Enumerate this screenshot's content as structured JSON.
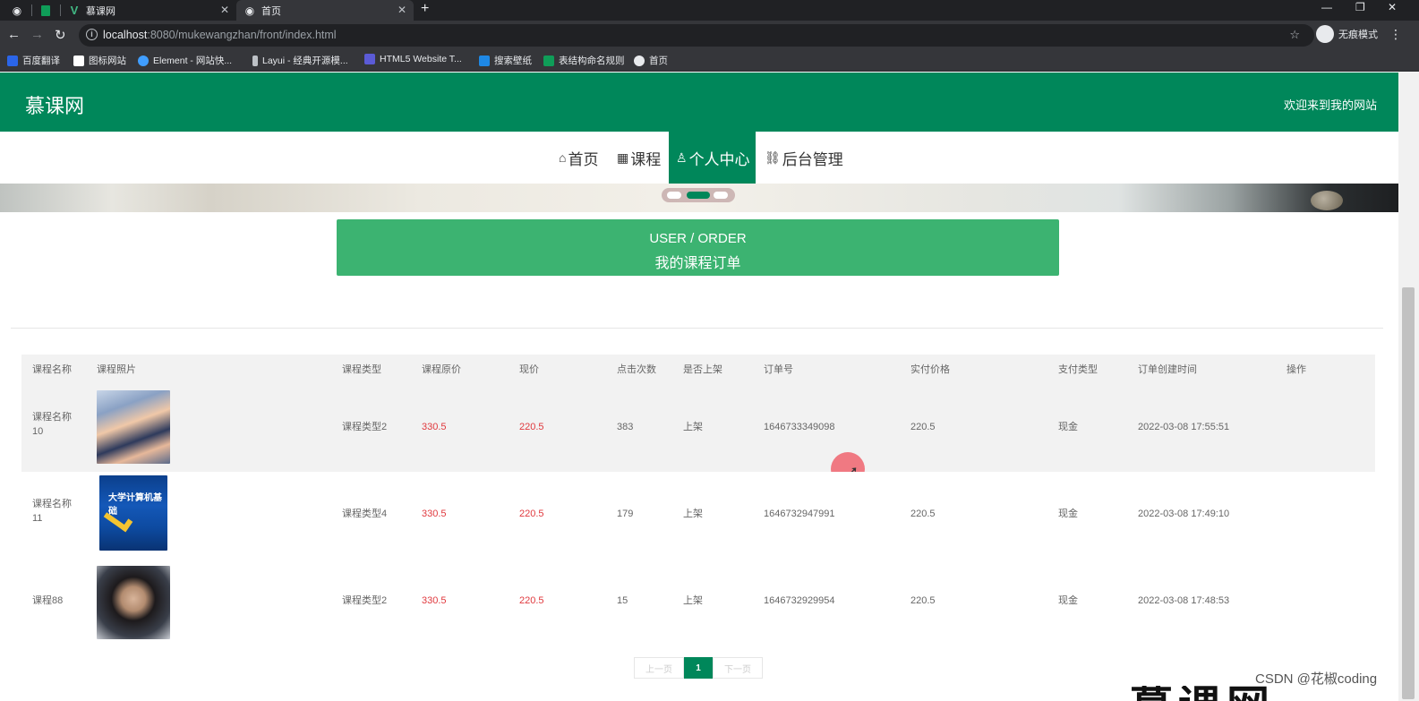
{
  "browser": {
    "tabs": [
      {
        "title": "慕课网"
      },
      {
        "title": "首页"
      }
    ],
    "url": {
      "host": "localhost",
      "rest": ":8080/mukewangzhan/front/index.html"
    },
    "incognito_label": "无痕模式",
    "bookmarks": [
      {
        "label": "百度翻译",
        "color": "#2b65e8"
      },
      {
        "label": "图标网站",
        "color": "#ffffff"
      },
      {
        "label": "Element - 网站快...",
        "color": "#409eff"
      },
      {
        "label": "Layui - 经典开源模...",
        "color": "#e8eaed"
      },
      {
        "label": "HTML5 Website T...",
        "color": "#5b5bd6"
      },
      {
        "label": "搜索壁纸",
        "color": "#1e88e5"
      },
      {
        "label": "表结构命名规则",
        "color": "#0f9d58"
      },
      {
        "label": "首页",
        "color": "#e8eaed"
      }
    ]
  },
  "site": {
    "logo": "慕课网",
    "welcome": "欢迎来到我的网站",
    "nav": [
      {
        "label": "首页",
        "icon": "home-icon",
        "glyph": "⌂"
      },
      {
        "label": "课程",
        "icon": "grid-icon",
        "glyph": "▦"
      },
      {
        "label": "个人中心",
        "icon": "user-icon",
        "glyph": "♙"
      },
      {
        "label": "后台管理",
        "icon": "link-icon",
        "glyph": "⛓"
      }
    ]
  },
  "order_banner": {
    "en": "USER / ORDER",
    "cn": "我的课程订单"
  },
  "table": {
    "headers": [
      "课程名称",
      "课程照片",
      "课程类型",
      "课程原价",
      "现价",
      "点击次数",
      "是否上架",
      "订单号",
      "实付价格",
      "支付类型",
      "订单创建时间",
      "操作"
    ],
    "rows": [
      {
        "name": "课程名称\n10",
        "type": "课程类型2",
        "orig_price": "330.5",
        "price": "220.5",
        "clicks": "383",
        "status": "上架",
        "order_no": "1646733349098",
        "paid": "220.5",
        "pay_type": "现金",
        "created": "2022-03-08 17:55:51"
      },
      {
        "name": "课程名称\n11",
        "type": "课程类型4",
        "orig_price": "330.5",
        "price": "220.5",
        "clicks": "179",
        "status": "上架",
        "order_no": "1646732947991",
        "paid": "220.5",
        "pay_type": "现金",
        "created": "2022-03-08 17:49:10"
      },
      {
        "name": "课程88",
        "type": "课程类型2",
        "orig_price": "330.5",
        "price": "220.5",
        "clicks": "15",
        "status": "上架",
        "order_no": "1646732929954",
        "paid": "220.5",
        "pay_type": "现金",
        "created": "2022-03-08 17:48:53"
      }
    ]
  },
  "thumb2_title": "大学计算机基础",
  "pager": {
    "prev": "上一页",
    "current": "1",
    "next": "下一页"
  },
  "watermark": "CSDN @花椒coding",
  "bottom_text": "慕课网"
}
